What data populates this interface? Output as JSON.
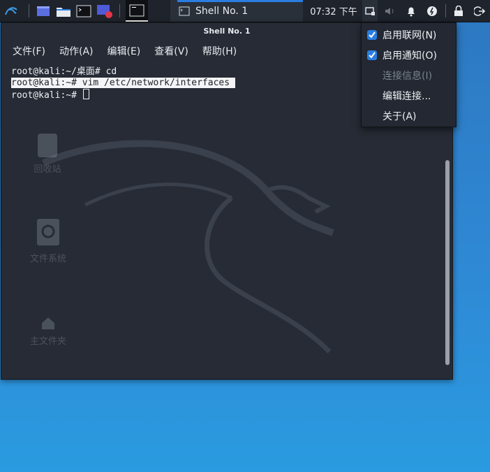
{
  "panel": {
    "task_label": "Shell No. 1",
    "clock": "07:32 下午",
    "launchers": [
      "workspace-switcher-icon",
      "file-manager-icon",
      "terminal-icon",
      "screen-recorder-icon"
    ],
    "tray": [
      "network-icon",
      "volume-icon",
      "notifications-icon",
      "power-icon",
      "lock-icon",
      "logout-icon"
    ]
  },
  "terminal": {
    "title": "Shell No. 1",
    "menu": [
      "文件(F)",
      "动作(A)",
      "编辑(E)",
      "查看(V)",
      "帮助(H)"
    ],
    "lines": [
      "root@kali:~/桌面# cd",
      "root@kali:~# vim /etc/network/interfaces",
      "root@kali:~# "
    ]
  },
  "desktop_icons": [
    "回收站",
    "文件系统",
    "主文件夹"
  ],
  "network_menu": {
    "items": [
      {
        "label": "启用联网(N)",
        "checked": true,
        "enabled": true
      },
      {
        "label": "启用通知(O)",
        "checked": true,
        "enabled": true
      },
      {
        "label": "连接信息(I)",
        "checked": false,
        "enabled": false
      },
      {
        "label": "编辑连接...",
        "checked": false,
        "enabled": true
      },
      {
        "label": "关于(A)",
        "checked": false,
        "enabled": true
      }
    ]
  },
  "colors": {
    "accent": "#2a7de1",
    "panel_bg": "#1f232b",
    "terminal_bg": "#262b35"
  }
}
